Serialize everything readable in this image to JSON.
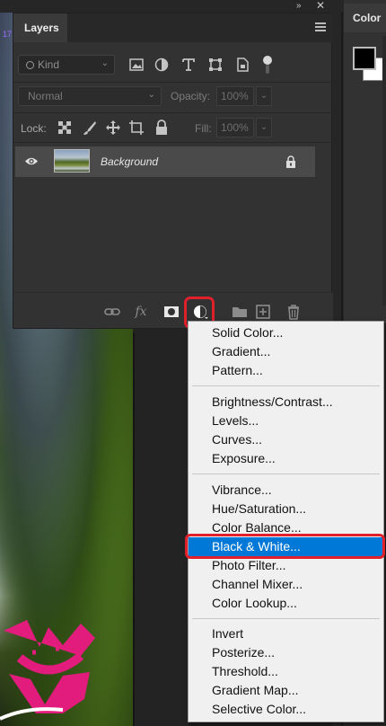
{
  "panel": {
    "tab_title": "Layers",
    "color_tab_title": "Color",
    "side_number": "17",
    "kind_filter": "Kind",
    "blend_mode": "Normal",
    "opacity_label": "Opacity:",
    "opacity_value": "100%",
    "lock_label": "Lock:",
    "fill_label": "Fill:",
    "fill_value": "100%",
    "layers": [
      {
        "name": "Background",
        "visible": true,
        "locked": true
      }
    ],
    "bottom_icons": [
      "link-icon",
      "fx-icon",
      "mask-icon",
      "adjustment-layer-icon",
      "group-folder-icon",
      "new-layer-icon",
      "trash-icon"
    ]
  },
  "adjustment_menu": {
    "groups": [
      [
        "Solid Color...",
        "Gradient...",
        "Pattern..."
      ],
      [
        "Brightness/Contrast...",
        "Levels...",
        "Curves...",
        "Exposure..."
      ],
      [
        "Vibrance...",
        "Hue/Saturation...",
        "Color Balance...",
        "Black & White...",
        "Photo Filter...",
        "Channel Mixer...",
        "Color Lookup..."
      ],
      [
        "Invert",
        "Posterize...",
        "Threshold...",
        "Gradient Map...",
        "Selective Color..."
      ]
    ],
    "selected_item": "Black & White..."
  },
  "colors": {
    "highlight_outline": "#e0202a",
    "menu_selected": "#0078d7",
    "panel_bg": "#323232"
  }
}
